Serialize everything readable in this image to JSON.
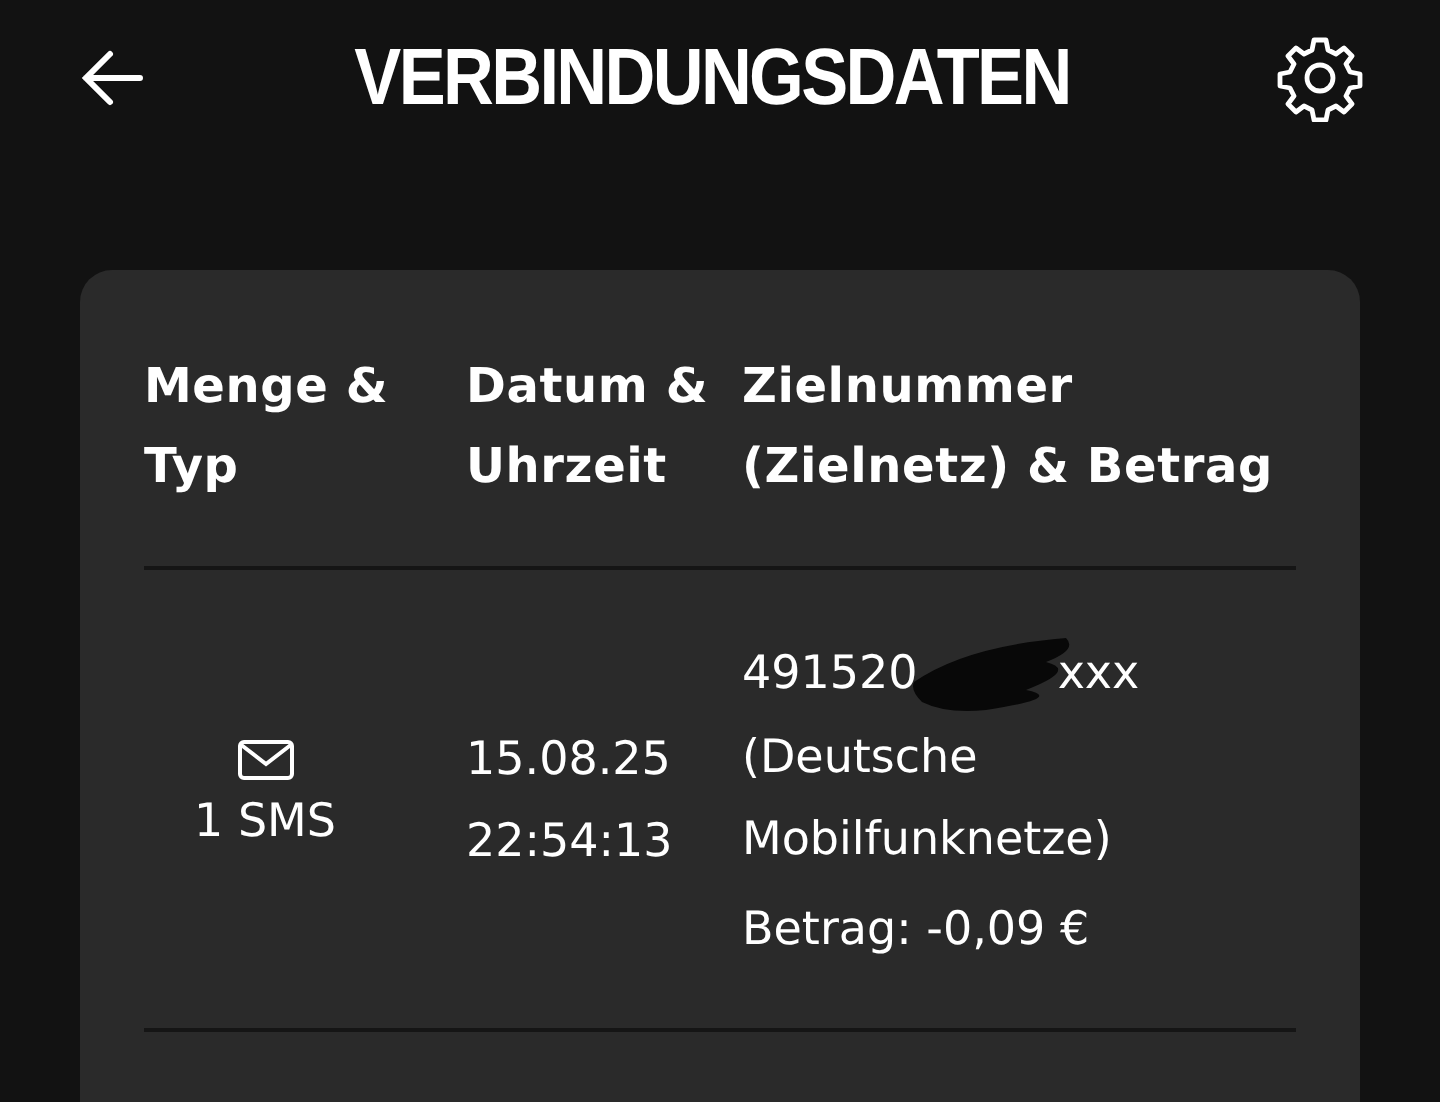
{
  "header": {
    "title": "VERBINDUNGSDATEN"
  },
  "table": {
    "columns": [
      "Menge & Typ",
      "Datum & Uhrzeit",
      "Zielnummer (Zielnetz) & Betrag"
    ],
    "rows": [
      {
        "kind": "sms",
        "amount": "1 SMS",
        "date": "15.08.25",
        "time": "22:54:13",
        "number_start": "491520",
        "number_end": "xxx",
        "network": "(Deutsche Mobilfunknetze)",
        "price": "Betrag: -0,09 €"
      }
    ]
  }
}
